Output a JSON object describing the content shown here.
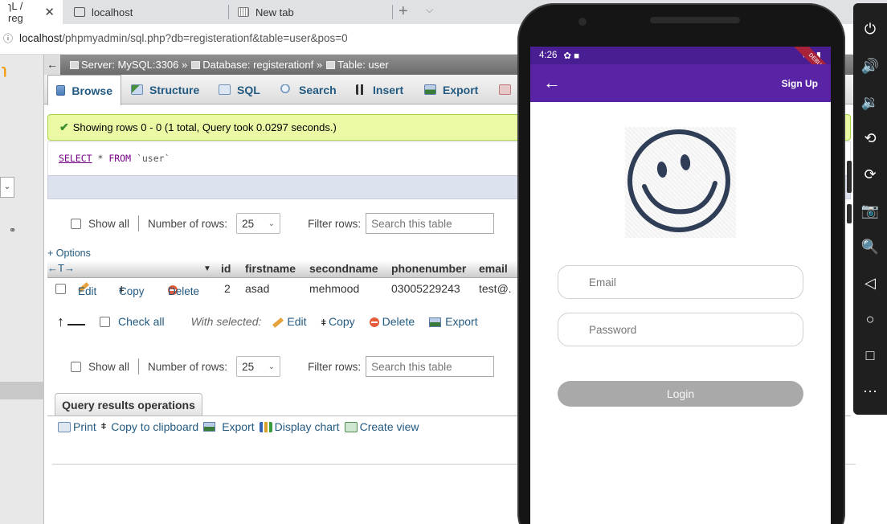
{
  "browser": {
    "tabs": [
      {
        "label": "ɿL / reg",
        "close": "✕"
      },
      {
        "label": "localhost"
      },
      {
        "label": "New tab"
      }
    ],
    "new_tab_glyph": "+",
    "tab_menu_glyph": "⌵",
    "url_host": "localhost",
    "url_path": "/phpmyadmin/sql.php?db=registerationf&table=user&pos=0",
    "info_glyph": "ⓘ"
  },
  "pma": {
    "logo_glyph": "ɿ",
    "left_select_glyph": "⌄",
    "left_link_glyph": "⚭",
    "breadcrumb": {
      "back": "←",
      "server": "Server: MySQL:3306 »",
      "database": "Database: registerationf »",
      "table": "Table: user"
    },
    "tabs": [
      "Browse",
      "Structure",
      "SQL",
      "Search",
      "Insert",
      "Export"
    ],
    "success": {
      "check": "✔",
      "message": "Showing rows 0 - 0 (1 total, Query took 0.0297 seconds.)"
    },
    "sql": {
      "keyword1": "SELECT",
      "star": " * ",
      "keyword2": "FROM",
      "table": " `user`"
    },
    "nav": {
      "show_all": "Show all",
      "rows_label": "Number of rows:",
      "rows_value": "25",
      "rows_chev": "⌄",
      "filter_label": "Filter rows:",
      "filter_placeholder": "Search this table"
    },
    "options_link": "+ Options",
    "table": {
      "arrows": "←T→",
      "sort_glyph": "▼",
      "columns": [
        "id",
        "firstname",
        "secondname",
        "phonenumber",
        "email"
      ],
      "rows": [
        {
          "edit": "Edit",
          "copy": "Copy",
          "delete": "Delete",
          "id": "2",
          "firstname": "asad",
          "secondname": "mehmood",
          "phonenumber": "03005229243",
          "email": "test@."
        }
      ]
    },
    "with_selected": {
      "arrow": "↑",
      "check_all": "Check all",
      "label": "With selected:",
      "edit": "Edit",
      "copy": "Copy",
      "delete": "Delete",
      "export": "Export"
    },
    "query_ops": {
      "title": "Query results operations",
      "links": [
        "Print",
        "Copy to clipboard",
        "Export",
        "Display chart",
        "Create view"
      ]
    },
    "copy_glyph": "ǂ"
  },
  "phone": {
    "time": "4:26",
    "status_icons_left": "✿ ■",
    "status_icons_right": "▾◢▮",
    "debug_banner": "DEBUG",
    "appbar": {
      "back": "←",
      "action": "Sign Up"
    },
    "email_placeholder": "Email",
    "password_placeholder": "Password",
    "login_label": "Login"
  },
  "emulator_toolbar": {
    "icons": [
      "⏻",
      "🔊",
      "🔉",
      "⟲",
      "⟳",
      "📷",
      "🔍",
      "◁",
      "○",
      "□",
      "⋯"
    ]
  }
}
